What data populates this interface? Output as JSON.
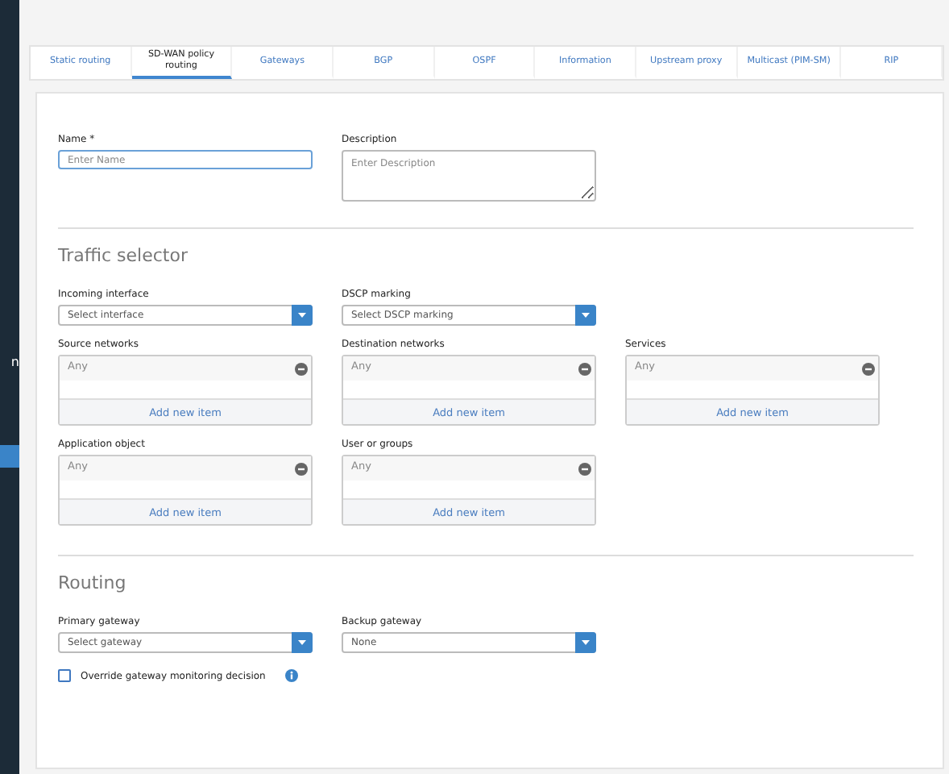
{
  "sidebar": {
    "items": [
      {
        "label": "n",
        "selected": false
      },
      {
        "selected": true
      }
    ]
  },
  "tabs": [
    {
      "label": "Static routing",
      "selected": false
    },
    {
      "label": "SD-WAN policy routing",
      "selected": true
    },
    {
      "label": "Gateways",
      "selected": false
    },
    {
      "label": "BGP",
      "selected": false
    },
    {
      "label": "OSPF",
      "selected": false
    },
    {
      "label": "Information",
      "selected": false
    },
    {
      "label": "Upstream proxy",
      "selected": false
    },
    {
      "label": "Multicast (PIM-SM)",
      "selected": false
    },
    {
      "label": "RIP",
      "selected": false
    }
  ],
  "general": {
    "name": {
      "label": "Name *",
      "placeholder": "Enter Name"
    },
    "description": {
      "label": "Description",
      "placeholder": "Enter Description"
    }
  },
  "traffic_selector": {
    "title": "Traffic selector",
    "selects": [
      {
        "label": "Incoming interface",
        "placeholder": "Select interface"
      },
      {
        "label": "DSCP marking",
        "placeholder": "Select DSCP marking"
      }
    ],
    "lists": [
      {
        "label": "Source networks",
        "item": "Any",
        "add": "Add new item"
      },
      {
        "label": "Destination networks",
        "item": "Any",
        "add": "Add new item"
      },
      {
        "label": "Services",
        "item": "Any",
        "add": "Add new item"
      },
      {
        "label": "Application object",
        "item": "Any",
        "add": "Add new item"
      },
      {
        "label": "User or groups",
        "item": "Any",
        "add": "Add new item"
      }
    ]
  },
  "routing": {
    "title": "Routing",
    "selects": [
      {
        "label": "Primary gateway",
        "placeholder": "Select gateway"
      },
      {
        "label": "Backup gateway",
        "value": "None"
      }
    ],
    "override": {
      "label": "Override gateway monitoring decision",
      "checked": false
    }
  }
}
